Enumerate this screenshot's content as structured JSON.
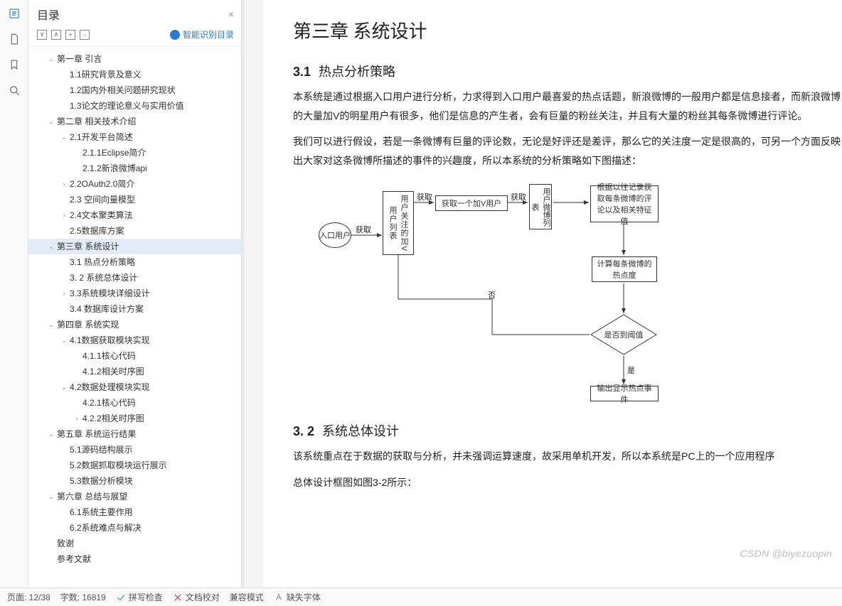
{
  "rail": {
    "icons": [
      "outline-icon",
      "page-icon",
      "bookmark-icon",
      "search-icon"
    ]
  },
  "outline": {
    "title": "目录",
    "close": "×",
    "smart": "智能识别目录",
    "tools": {
      "collapse": "∨",
      "expand": "∧",
      "plus": "+",
      "minus": "-"
    }
  },
  "tree": [
    {
      "depth": 1,
      "caret": "down",
      "label": "第一章 引言"
    },
    {
      "depth": 2,
      "caret": "none",
      "label": "1.1研究背景及意义"
    },
    {
      "depth": 2,
      "caret": "none",
      "label": "1.2国内外相关问题研究现状"
    },
    {
      "depth": 2,
      "caret": "none",
      "label": "1.3论文的理论意义与实用价值"
    },
    {
      "depth": 1,
      "caret": "down",
      "label": "第二章 相关技术介绍"
    },
    {
      "depth": 2,
      "caret": "down",
      "label": "2.1开发平台简述"
    },
    {
      "depth": 3,
      "caret": "none",
      "label": "2.1.1Eclipse简介"
    },
    {
      "depth": 3,
      "caret": "none",
      "label": "2.1.2新浪微博api"
    },
    {
      "depth": 2,
      "caret": "right",
      "label": "2.2OAuth2.0简介"
    },
    {
      "depth": 2,
      "caret": "none",
      "label": "2.3 空间向量模型"
    },
    {
      "depth": 2,
      "caret": "right",
      "label": "2.4文本聚类算法"
    },
    {
      "depth": 2,
      "caret": "none",
      "label": "2.5数据库方案"
    },
    {
      "depth": 1,
      "caret": "down",
      "label": "第三章 系统设计",
      "selected": true
    },
    {
      "depth": 2,
      "caret": "none",
      "label": "3.1 热点分析策略"
    },
    {
      "depth": 2,
      "caret": "none",
      "label": "3. 2 系统总体设计"
    },
    {
      "depth": 2,
      "caret": "right",
      "label": "3.3系统模块详细设计"
    },
    {
      "depth": 2,
      "caret": "none",
      "label": "3.4 数据库设计方案"
    },
    {
      "depth": 1,
      "caret": "down",
      "label": "第四章 系统实现"
    },
    {
      "depth": 2,
      "caret": "down",
      "label": "4.1数据获取模块实现"
    },
    {
      "depth": 3,
      "caret": "none",
      "label": "4.1.1核心代码"
    },
    {
      "depth": 3,
      "caret": "none",
      "label": "4.1.2相关时序图"
    },
    {
      "depth": 2,
      "caret": "down",
      "label": "4.2数据处理模块实现"
    },
    {
      "depth": 3,
      "caret": "none",
      "label": "4.2.1核心代码"
    },
    {
      "depth": 3,
      "caret": "right",
      "label": "4.2.2相关时序图"
    },
    {
      "depth": 1,
      "caret": "down",
      "label": "第五章 系统运行结果"
    },
    {
      "depth": 2,
      "caret": "none",
      "label": "5.1源码结构展示"
    },
    {
      "depth": 2,
      "caret": "none",
      "label": "5.2数据抓取模块运行展示"
    },
    {
      "depth": 2,
      "caret": "none",
      "label": "5.3数据分析模块"
    },
    {
      "depth": 1,
      "caret": "down",
      "label": "第六章 总结与展望"
    },
    {
      "depth": 2,
      "caret": "none",
      "label": "6.1系统主要作用"
    },
    {
      "depth": 2,
      "caret": "none",
      "label": "6.2系统难点与解决"
    },
    {
      "depth": 1,
      "caret": "none",
      "label": "致谢"
    },
    {
      "depth": 1,
      "caret": "none",
      "label": "参考文献"
    }
  ],
  "doc": {
    "chapter": "第三章  系统设计",
    "sec31_num": "3.1",
    "sec31_title": "热点分析策略",
    "p1": "本系统是通过根据入口用户进行分析，力求得到入口用户最喜爱的热点话题，新浪微博的一般用户都是信息接者，而新浪微博的大量加V的明星用户有很多，他们是信息的产生者，会有巨量的粉丝关注，并且有大量的粉丝其每条微博进行评论。",
    "p2": "我们可以进行假设，若是一条微博有巨量的评论数，无论是好评还是差评，那么它的关注度一定是很高的，可另一个方面反映出大家对这条微博所描述的事件的兴趣度，所以本系统的分析策略如下图描述：",
    "sec32_num": "3. 2",
    "sec32_title": "系统总体设计",
    "p3": "该系统重点在于数据的获取与分析，并未强调运算速度，故采用单机开发，所以本系统是PC上的一个应用程序",
    "p4": "总体设计框图如图3-2所示："
  },
  "flow": {
    "entry": "入口用户",
    "listV": "用户关注的加V用户列表",
    "getOneV": "获取一个加V用户",
    "weiboList": "用户微博列表",
    "features": "根据以往记录获取每条微博的评论以及相关特征值",
    "calcHot": "计算每条微博的热点度",
    "threshold": "是否到阈值",
    "output": "输出显示热点事件",
    "edge_get": "获取",
    "edge_no": "否",
    "edge_yes": "是"
  },
  "status": {
    "page": "页面: 12/38",
    "words": "字数: 16819",
    "spell": "拼写检查",
    "proof": "文档校对",
    "compat": "兼容模式",
    "fonts": "缺失字体"
  },
  "watermark": "CSDN @biyezuopin"
}
